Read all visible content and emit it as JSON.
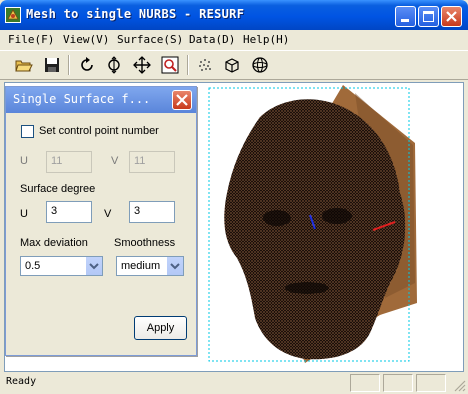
{
  "window": {
    "title": "Mesh to single NURBS - RESURF"
  },
  "menu": {
    "items": [
      {
        "label": "File(F)"
      },
      {
        "label": "View(V)"
      },
      {
        "label": "Surface(S)"
      },
      {
        "label": "Data(D)"
      },
      {
        "label": "Help(H)"
      }
    ]
  },
  "toolbar": {
    "tools": [
      "open-icon",
      "save-icon",
      "rotate-icon",
      "zoom-icon",
      "pan-icon",
      "zoom-window-icon",
      "point-cloud-icon",
      "cube-icon",
      "sphere-icon"
    ]
  },
  "panel": {
    "title": "Single Surface f...",
    "checkbox_label": "Set control point number",
    "checked": false,
    "u_label": "U",
    "v_label": "V",
    "u_count": "11",
    "v_count": "11",
    "surface_degree_label": "Surface degree",
    "u_degree": "3",
    "v_degree": "3",
    "max_deviation_label": "Max deviation",
    "max_deviation_value": "0.5",
    "smoothness_label": "Smoothness",
    "smoothness_value": "medium",
    "apply_label": "Apply"
  },
  "status": {
    "text": "Ready"
  },
  "colors": {
    "title_bar": "#0054E3",
    "mesh_dark": "#1A0F0A",
    "mesh_light": "#C8895A",
    "surface": "#A06A3A",
    "bbox": "#00C8E6",
    "axis_x": "#E02020",
    "axis_y": "#2030E0"
  }
}
